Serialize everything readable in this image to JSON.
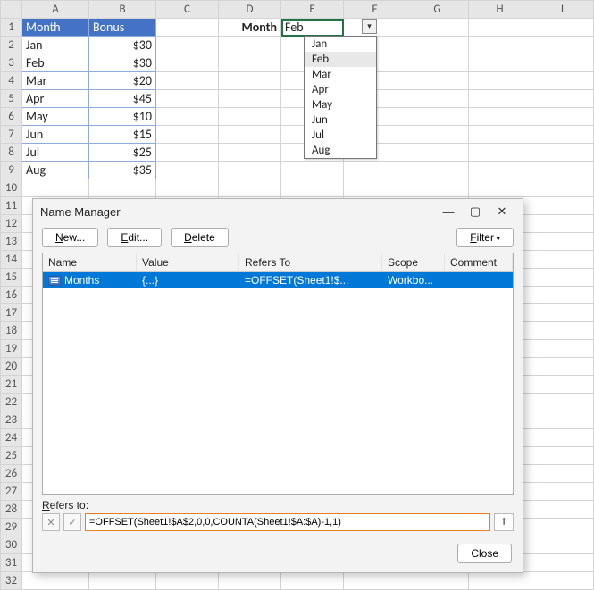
{
  "headers": {
    "cols": [
      "A",
      "B",
      "C",
      "D",
      "E",
      "F",
      "G",
      "H",
      "I"
    ],
    "rows": [
      "1",
      "2",
      "3",
      "4",
      "5",
      "6",
      "7",
      "8",
      "9",
      "10",
      "11",
      "12",
      "13",
      "14",
      "15",
      "16",
      "17",
      "18",
      "19",
      "20",
      "21",
      "22",
      "23",
      "24",
      "25",
      "26",
      "27",
      "28",
      "29",
      "30",
      "31",
      "32"
    ]
  },
  "sheet": {
    "A1": "Month",
    "B1": "Bonus",
    "A2": "Jan",
    "B2": "$30",
    "A3": "Feb",
    "B3": "$30",
    "A4": "Mar",
    "B4": "$20",
    "A5": "Apr",
    "B5": "$45",
    "A6": "May",
    "B6": "$10",
    "A7": "Jun",
    "B7": "$15",
    "A8": "Jul",
    "B8": "$25",
    "A9": "Aug",
    "B9": "$35",
    "D1": "Month",
    "E1": "Feb"
  },
  "dropdown": {
    "items": [
      "Jan",
      "Feb",
      "Mar",
      "Apr",
      "May",
      "Jun",
      "Jul",
      "Aug"
    ],
    "selected_index": 1
  },
  "dialog": {
    "title": "Name Manager",
    "buttons": {
      "new": "New...",
      "edit": "Edit...",
      "delete": "Delete",
      "filter": "Filter",
      "close": "Close"
    },
    "columns": {
      "name": "Name",
      "value": "Value",
      "refers": "Refers To",
      "scope": "Scope",
      "comment": "Comment"
    },
    "rows": [
      {
        "name": "Months",
        "value": "{...}",
        "refers": "=OFFSET(Sheet1!$...",
        "scope": "Workbo...",
        "comment": ""
      }
    ],
    "refers_label": "Refers to:",
    "refers_value": "=OFFSET(Sheet1!$A$2,0,0,COUNTA(Sheet1!$A:$A)-1,1)"
  }
}
